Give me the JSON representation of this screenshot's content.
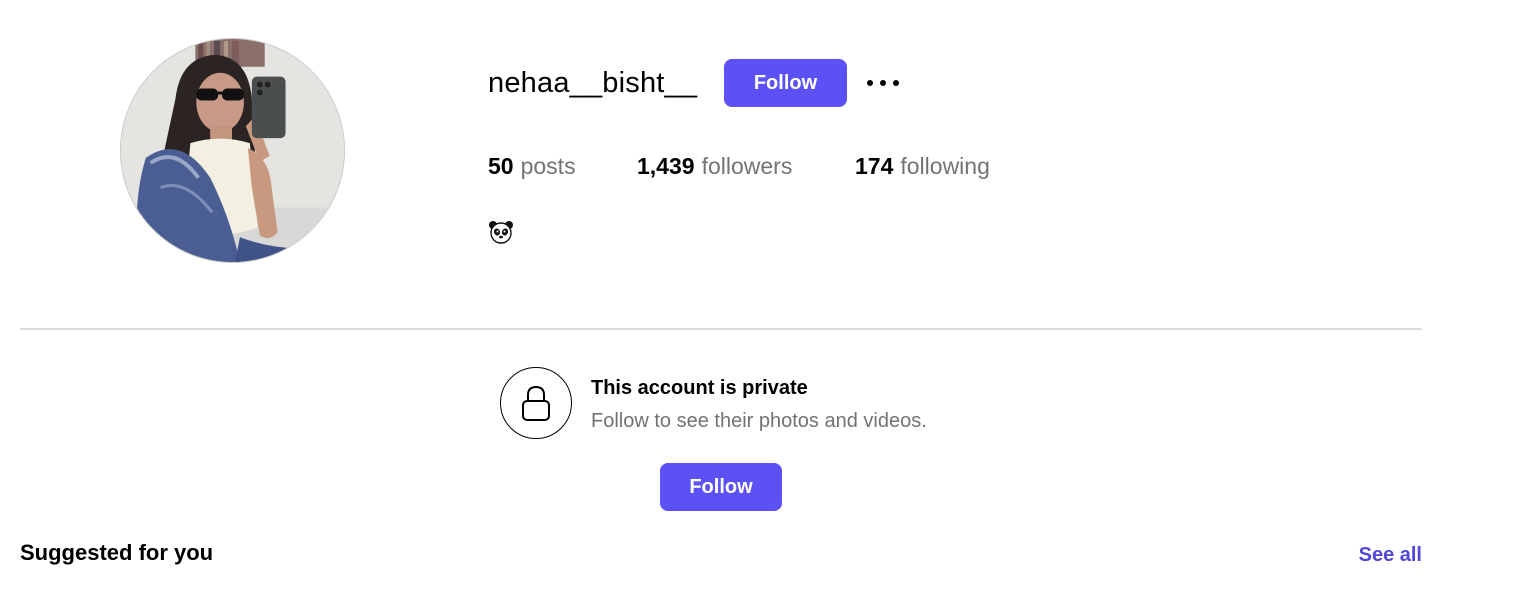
{
  "profile": {
    "username": "nehaa__bisht__",
    "follow_label": "Follow",
    "bio_emoji": "🐼"
  },
  "stats": {
    "posts": {
      "count": "50",
      "label": "posts"
    },
    "followers": {
      "count": "1,439",
      "label": "followers"
    },
    "following": {
      "count": "174",
      "label": "following"
    }
  },
  "private_notice": {
    "title": "This account is private",
    "subtitle": "Follow to see their photos and videos.",
    "follow_label": "Follow"
  },
  "suggested": {
    "title": "Suggested for you",
    "see_all_label": "See all"
  },
  "colors": {
    "accent": "#5b51f5",
    "link": "#4f47d8",
    "muted_text": "#737373",
    "divider": "#dbdbdb"
  },
  "icons": {
    "more": "more-horizontal-icon",
    "lock": "lock-icon",
    "panda": "panda-emoji"
  }
}
